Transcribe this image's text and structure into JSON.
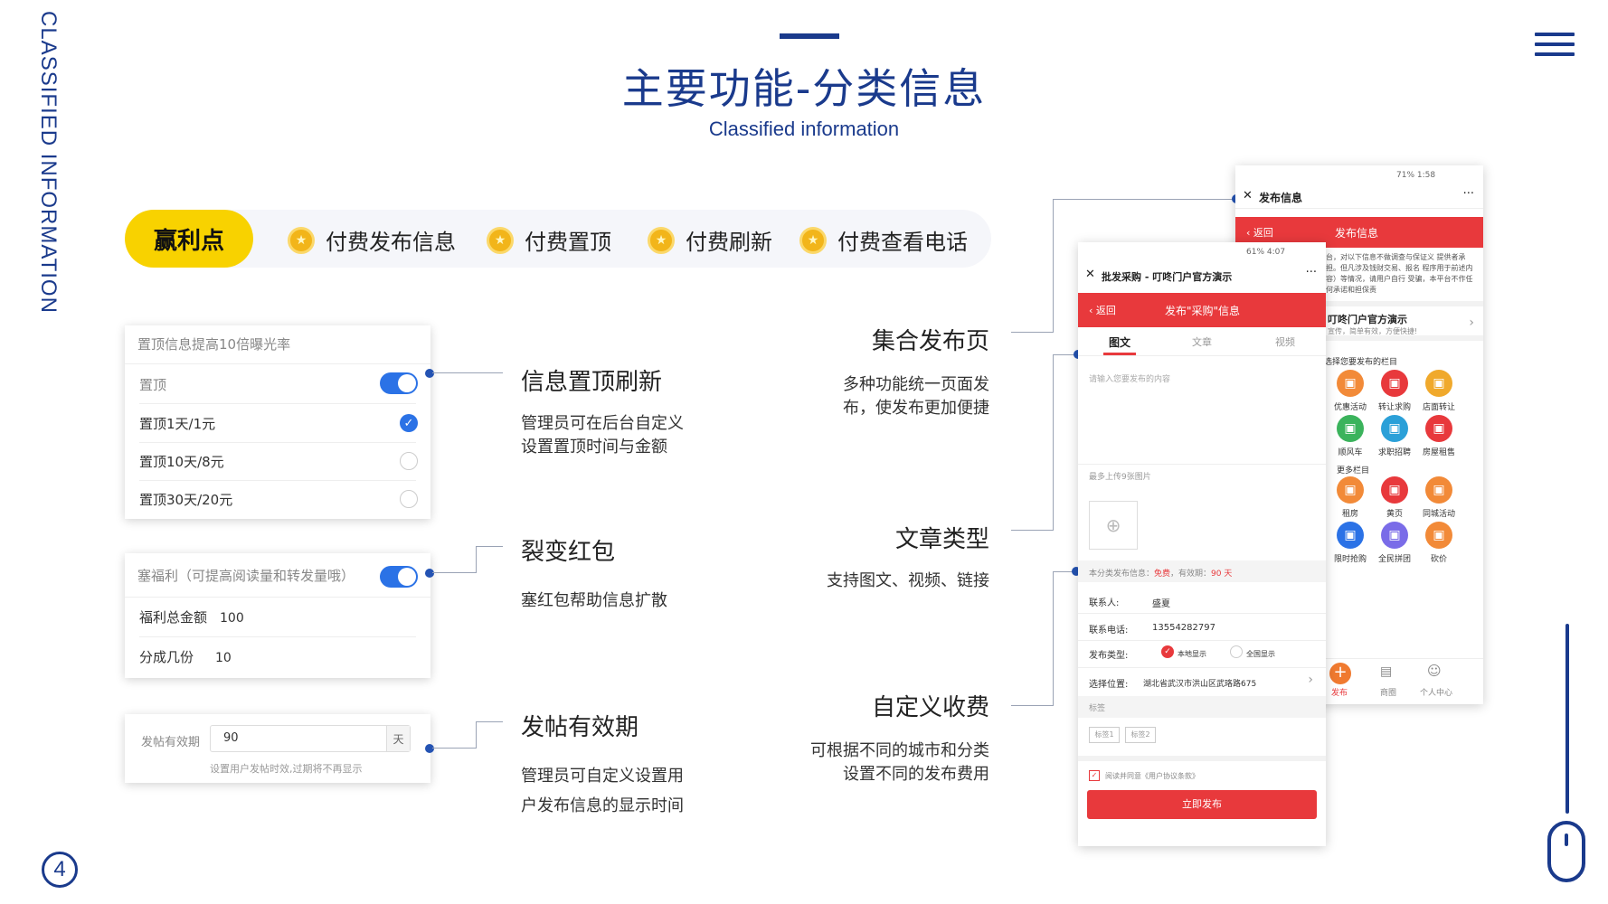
{
  "side_title": "CLASSIFIED INFORMATION",
  "header": {
    "title": "主要功能-分类信息",
    "subtitle": "Classified information"
  },
  "page_number": "4",
  "profit": {
    "badge": "赢利点",
    "items": [
      "付费发布信息",
      "付费置顶",
      "付费刷新",
      "付费查看电话"
    ]
  },
  "top_card": {
    "title": "置顶信息提高10倍曝光率",
    "toggle_label": "置顶",
    "toggle_on": true,
    "options": [
      "置顶1天/1元",
      "置顶10天/8元",
      "置顶30天/20元"
    ],
    "selected_index": 0
  },
  "redpacket_card": {
    "title": "塞福利（可提高阅读量和转发量哦）",
    "toggle_on": true,
    "total_label": "福利总金额",
    "total_value": "100",
    "parts_label": "分成几份",
    "parts_value": "10"
  },
  "valid_card": {
    "label": "发帖有效期",
    "value": "90",
    "unit": "天",
    "hint": "设置用户发帖时效,过期将不再显示"
  },
  "features_left": [
    {
      "title": "信息置顶刷新",
      "desc1": "管理员可在后台自定义",
      "desc2": "设置置顶时间与金额"
    },
    {
      "title": "裂变红包",
      "desc1": "塞红包帮助信息扩散",
      "desc2": ""
    },
    {
      "title": "发帖有效期",
      "desc1": "管理员可自定义设置用",
      "desc2": "户发布信息的显示时间"
    }
  ],
  "features_right": [
    {
      "title": "集合发布页",
      "desc1": "多种功能统一页面发",
      "desc2": "布，使发布更加便捷"
    },
    {
      "title": "文章类型",
      "desc1": "支持图文、视频、链接",
      "desc2": ""
    },
    {
      "title": "自定义收费",
      "desc1": "可根据不同的城市和分类",
      "desc2": "设置不同的发布费用"
    }
  ],
  "phone_back": {
    "status_right": "71% 1:58",
    "close": "✕",
    "title": "发布信息",
    "more": "···",
    "back": "返回",
    "red_title": "发布信息",
    "notice": "台，对以下信息不做调查与保证义 提供者承担。但凡涉及钱财交易、报名 程序用于前述内容）等情况，请用户自行 受骗，本平台不作任何承诺和担保责",
    "promo_title": "叮咚门户官方演示",
    "promo_sub": "宣传，简单有效，方便快捷!",
    "choose_label": "选择您要发布的栏目",
    "icons": [
      {
        "label": "优惠活动",
        "color": "#f28a38"
      },
      {
        "label": "转让求购",
        "color": "#e8393c"
      },
      {
        "label": "店面转让",
        "color": "#f0a92c"
      },
      {
        "label": "顺风车",
        "color": "#3bb35c"
      },
      {
        "label": "求职招聘",
        "color": "#2ba0d8"
      },
      {
        "label": "房屋租售",
        "color": "#e8393c"
      }
    ],
    "more_label": "更多栏目",
    "icons2": [
      {
        "label": "租房",
        "color": "#f28a38"
      },
      {
        "label": "黄页",
        "color": "#e8393c"
      },
      {
        "label": "同城活动",
        "color": "#f28a38"
      },
      {
        "label": "限时抢购",
        "color": "#2b72e6"
      },
      {
        "label": "全民拼团",
        "color": "#7a6ce8"
      },
      {
        "label": "砍价",
        "color": "#f28a38"
      }
    ],
    "tabbar": [
      "发布",
      "商圈",
      "个人中心"
    ]
  },
  "phone_front": {
    "status_right": "61% 4:07",
    "close": "✕",
    "title": "批发采购 - 叮咚门户官方演示",
    "more": "···",
    "back": "返回",
    "red_title": "发布\"采购\"信息",
    "tabs": [
      "图文",
      "文章",
      "视频"
    ],
    "active_tab": 0,
    "content_placeholder": "请输入您要发布的内容",
    "upload_label": "最多上传9张图片",
    "fee_prefix": "本分类发布信息：",
    "fee_value": "免费",
    "fee_mid": "，有效期：",
    "fee_days": "90 天",
    "contact_label": "联系人:",
    "contact_value": "盛夏",
    "phone_label": "联系电话:",
    "phone_value": "13554282797",
    "type_label": "发布类型:",
    "type_opt1": "本地显示",
    "type_opt2": "全国显示",
    "loc_label": "选择位置:",
    "loc_value": "湖北省武汉市洪山区武珞路675",
    "tag_section": "标签",
    "tags": [
      "标签1",
      "标签2"
    ],
    "agree_text": "阅读并同意《用户协议条款》",
    "submit": "立即发布"
  }
}
